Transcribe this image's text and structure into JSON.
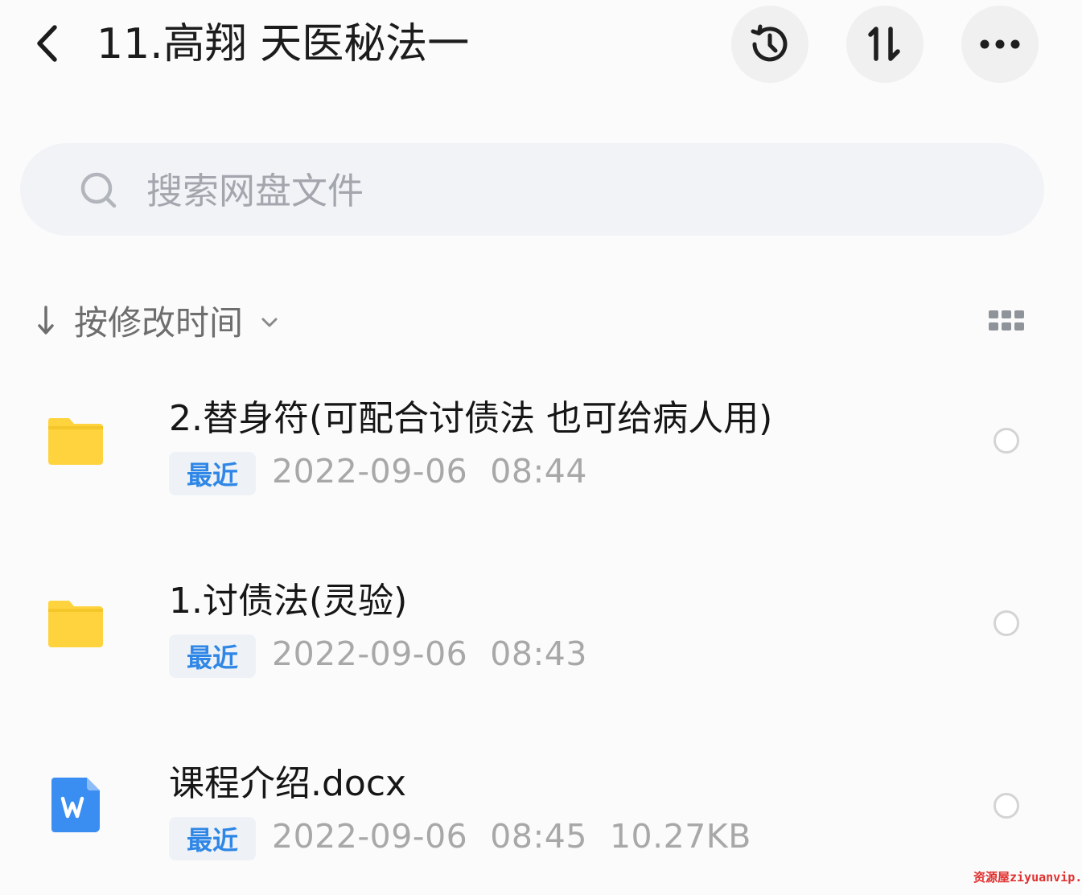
{
  "header": {
    "title": "11.高翔 天医秘法一",
    "icons": {
      "back": "chevron-left-icon",
      "history": "history-icon",
      "sort": "sort-icon",
      "more": "more-icon"
    }
  },
  "search": {
    "placeholder": "搜索网盘文件",
    "value": "",
    "icon": "search-icon"
  },
  "sort_bar": {
    "label": "按修改时间",
    "direction_icon": "arrow-down-icon",
    "dropdown_icon": "chevron-down-icon",
    "view_icon": "grid-view-icon"
  },
  "files": [
    {
      "name": "2.替身符(可配合讨债法 也可给病人用)",
      "type": "folder",
      "badge": "最近",
      "date": "2022-09-06",
      "time": "08:44",
      "size": ""
    },
    {
      "name": "1.讨债法(灵验)",
      "type": "folder",
      "badge": "最近",
      "date": "2022-09-06",
      "time": "08:43",
      "size": ""
    },
    {
      "name": "课程介绍.docx",
      "type": "word-document",
      "badge": "最近",
      "date": "2022-09-06",
      "time": "08:45",
      "size": "10.27KB"
    }
  ],
  "watermark": "资源屋ziyuanvip.cn",
  "colors": {
    "folder": "#ffd33d",
    "word_icon": "#3a8ef2",
    "badge_text": "#2e86e6",
    "badge_bg": "#eef2f6"
  }
}
